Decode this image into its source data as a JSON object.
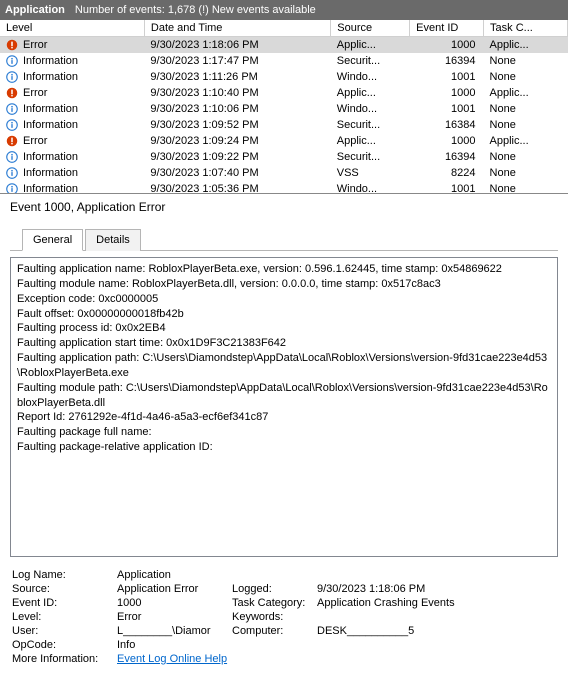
{
  "header": {
    "title": "Application",
    "subtitle": "Number of events: 1,678 (!) New events available"
  },
  "columns": [
    "Level",
    "Date and Time",
    "Source",
    "Event ID",
    "Task C..."
  ],
  "events": [
    {
      "level": "Error",
      "icon": "error",
      "date": "9/30/2023 1:18:06 PM",
      "source": "Applic...",
      "eventId": "1000",
      "task": "Applic...",
      "selected": true
    },
    {
      "level": "Information",
      "icon": "info",
      "date": "9/30/2023 1:17:47 PM",
      "source": "Securit...",
      "eventId": "16394",
      "task": "None"
    },
    {
      "level": "Information",
      "icon": "info",
      "date": "9/30/2023 1:11:26 PM",
      "source": "Windo...",
      "eventId": "1001",
      "task": "None"
    },
    {
      "level": "Error",
      "icon": "error",
      "date": "9/30/2023 1:10:40 PM",
      "source": "Applic...",
      "eventId": "1000",
      "task": "Applic..."
    },
    {
      "level": "Information",
      "icon": "info",
      "date": "9/30/2023 1:10:06 PM",
      "source": "Windo...",
      "eventId": "1001",
      "task": "None"
    },
    {
      "level": "Information",
      "icon": "info",
      "date": "9/30/2023 1:09:52 PM",
      "source": "Securit...",
      "eventId": "16384",
      "task": "None"
    },
    {
      "level": "Error",
      "icon": "error",
      "date": "9/30/2023 1:09:24 PM",
      "source": "Applic...",
      "eventId": "1000",
      "task": "Applic..."
    },
    {
      "level": "Information",
      "icon": "info",
      "date": "9/30/2023 1:09:22 PM",
      "source": "Securit...",
      "eventId": "16394",
      "task": "None"
    },
    {
      "level": "Information",
      "icon": "info",
      "date": "9/30/2023 1:07:40 PM",
      "source": "VSS",
      "eventId": "8224",
      "task": "None"
    },
    {
      "level": "Information",
      "icon": "info",
      "date": "9/30/2023 1:05:36 PM",
      "source": "Windo...",
      "eventId": "1001",
      "task": "None"
    }
  ],
  "detail": {
    "title": "Event 1000, Application Error",
    "tabs": {
      "general": "General",
      "details": "Details"
    },
    "messageLines": [
      "Faulting application name: RobloxPlayerBeta.exe, version: 0.596.1.62445, time stamp: 0x54869622",
      "Faulting module name: RobloxPlayerBeta.dll, version: 0.0.0.0, time stamp: 0x517c8ac3",
      "Exception code: 0xc0000005",
      "Fault offset: 0x00000000018fb42b",
      "Faulting process id: 0x0x2EB4",
      "Faulting application start time: 0x0x1D9F3C21383F642",
      "Faulting application path: C:\\Users\\Diamondstep\\AppData\\Local\\Roblox\\Versions\\version-9fd31cae223e4d53\\RobloxPlayerBeta.exe",
      "Faulting module path: C:\\Users\\Diamondstep\\AppData\\Local\\Roblox\\Versions\\version-9fd31cae223e4d53\\RobloxPlayerBeta.dll",
      "Report Id: 2761292e-4f1d-4a46-a5a3-ecf6ef341c87",
      "Faulting package full name:",
      "Faulting package-relative application ID:"
    ],
    "meta": {
      "logNameLabel": "Log Name:",
      "logName": "Application",
      "sourceLabel": "Source:",
      "source": "Application Error",
      "loggedLabel": "Logged:",
      "logged": "9/30/2023 1:18:06 PM",
      "eventIdLabel": "Event ID:",
      "eventId": "1000",
      "taskCategoryLabel": "Task Category:",
      "taskCategory": "Application Crashing Events",
      "levelLabel": "Level:",
      "level": "Error",
      "keywordsLabel": "Keywords:",
      "keywords": "",
      "userLabel": "User:",
      "user": "L________\\Diamor",
      "computerLabel": "Computer:",
      "computer": "DESK__________5",
      "opcodeLabel": "OpCode:",
      "opcode": "Info",
      "moreInfoLabel": "More Information:",
      "moreInfoLink": "Event Log Online Help"
    }
  }
}
